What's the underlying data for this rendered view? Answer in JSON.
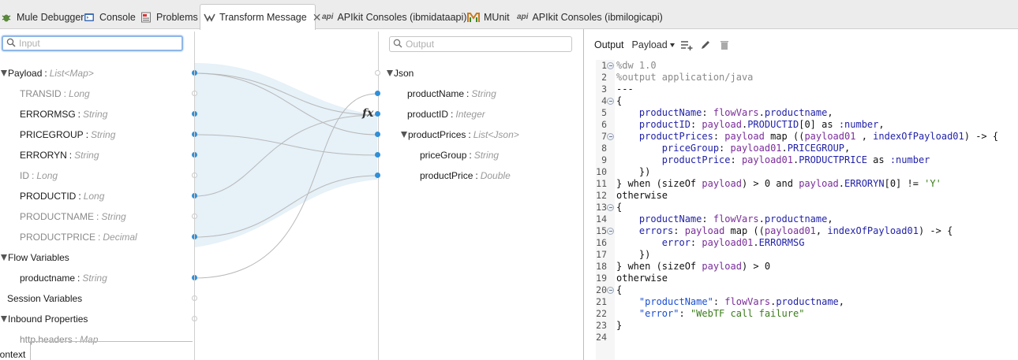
{
  "tabs": [
    {
      "label": "Mule Debugger",
      "icon": "bug-icon"
    },
    {
      "label": "Console",
      "icon": "console-icon"
    },
    {
      "label": "Problems",
      "icon": "problems-icon"
    },
    {
      "label": "Transform Message",
      "icon": "transform-icon",
      "active": true
    },
    {
      "label": "APIkit Consoles (ibmidataapi)",
      "icon": "api-icon",
      "badge": "api"
    },
    {
      "label": "MUnit",
      "icon": "munit-icon"
    },
    {
      "label": "APIkit Consoles (ibmilogicapi)",
      "icon": "api-icon",
      "badge": "api"
    }
  ],
  "input_pane": {
    "search_placeholder": "Input",
    "tree": [
      {
        "name": "Payload",
        "type": "List<Map>",
        "expanded": true,
        "mapped": true
      },
      {
        "name": "TRANSID",
        "type": "Long",
        "mapped": false
      },
      {
        "name": "ERRORMSG",
        "type": "String",
        "mapped": true
      },
      {
        "name": "PRICEGROUP",
        "type": "String",
        "mapped": true
      },
      {
        "name": "ERRORYN",
        "type": "String",
        "mapped": true
      },
      {
        "name": "ID",
        "type": "Long",
        "mapped": false
      },
      {
        "name": "PRODUCTID",
        "type": "Long",
        "mapped": true
      },
      {
        "name": "PRODUCTNAME",
        "type": "String",
        "mapped": false
      },
      {
        "name": "PRODUCTPRICE",
        "type": "Decimal",
        "mapped": true
      },
      {
        "name": "Flow Variables",
        "type": "",
        "expanded": true
      },
      {
        "name": "productname",
        "type": "String",
        "mapped": true
      },
      {
        "name": "Session Variables",
        "type": ""
      },
      {
        "name": "Inbound Properties",
        "type": "",
        "expanded": true
      },
      {
        "name": "http.headers",
        "type": "Map"
      }
    ],
    "context_label": "Context"
  },
  "output_tree": {
    "search_placeholder": "Output",
    "function_marker": "fx",
    "tree": [
      {
        "name": "Json",
        "type": "",
        "expanded": true
      },
      {
        "name": "productName",
        "type": "String"
      },
      {
        "name": "productID",
        "type": "Integer"
      },
      {
        "name": "productPrices",
        "type": "List<Json>",
        "expanded": true
      },
      {
        "name": "priceGroup",
        "type": "String"
      },
      {
        "name": "productPrice",
        "type": "Double"
      }
    ]
  },
  "editor": {
    "output_label": "Output",
    "selector": "Payload",
    "toolbar_icons": [
      "add-output-icon",
      "edit-icon",
      "delete-icon"
    ],
    "colors": {
      "mapped_dot": "#2f8fd8",
      "mapping_area": "#e6f1f8"
    },
    "fold_lines": [
      1,
      4,
      7,
      13,
      15,
      20
    ],
    "lines": [
      {
        "n": "1",
        "text": "%dw 1.0"
      },
      {
        "n": "2",
        "text": "%output application/java"
      },
      {
        "n": "3",
        "text": "---"
      },
      {
        "n": "4",
        "text": "{"
      },
      {
        "n": "5",
        "text": "    productName: flowVars.productname,"
      },
      {
        "n": "6",
        "text": "    productID: payload.PRODUCTID[0] as :number,"
      },
      {
        "n": "7",
        "text": "    productPrices: payload map ((payload01 , indexOfPayload01) -> {"
      },
      {
        "n": "8",
        "text": "        priceGroup: payload01.PRICEGROUP,"
      },
      {
        "n": "9",
        "text": "        productPrice: payload01.PRODUCTPRICE as :number"
      },
      {
        "n": "10",
        "text": "    })"
      },
      {
        "n": "11",
        "text": "} when (sizeOf payload) > 0 and payload.ERRORYN[0] != 'Y'"
      },
      {
        "n": "12",
        "text": "otherwise"
      },
      {
        "n": "13",
        "text": "{"
      },
      {
        "n": "14",
        "text": "    productName: flowVars.productname,"
      },
      {
        "n": "15",
        "text": "    errors: payload map ((payload01, indexOfPayload01) -> {"
      },
      {
        "n": "16",
        "text": "        error: payload01.ERRORMSG"
      },
      {
        "n": "17",
        "text": "    })"
      },
      {
        "n": "18",
        "text": "} when (sizeOf payload) > 0"
      },
      {
        "n": "19",
        "text": "otherwise"
      },
      {
        "n": "20",
        "text": "{"
      },
      {
        "n": "21",
        "text": "    \"productName\": flowVars.productname,"
      },
      {
        "n": "22",
        "text": "    \"error\": \"WebTF call failure\""
      },
      {
        "n": "23",
        "text": "}"
      },
      {
        "n": "24",
        "text": ""
      }
    ]
  }
}
